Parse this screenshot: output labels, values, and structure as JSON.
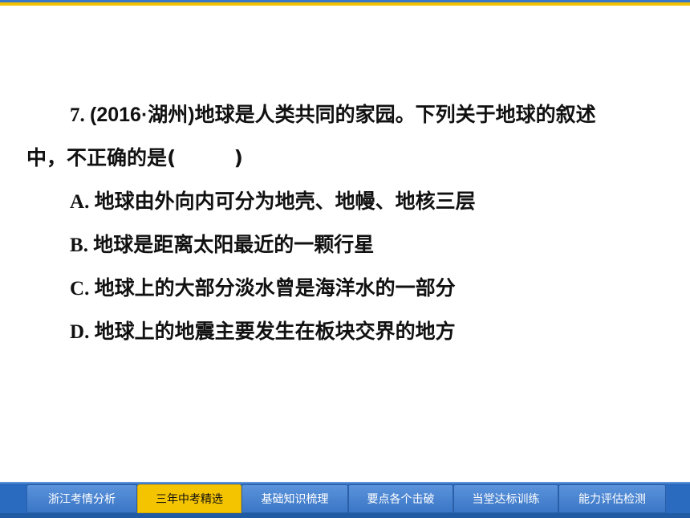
{
  "question": {
    "number": "7",
    "number_sep": ". ",
    "source": "(2016·湖州)",
    "stem_line1": "地球是人类共同的家园。下列关于地球的叙述",
    "stem_line2": "中，不正确的是(",
    "blank_close": ")",
    "options": [
      {
        "letter": "A",
        "sep": ". ",
        "text": "地球由外向内可分为地壳、地幔、地核三层"
      },
      {
        "letter": "B",
        "sep": ". ",
        "text": "地球是距离太阳最近的一颗行星"
      },
      {
        "letter": "C",
        "sep": ". ",
        "text": "地球上的大部分淡水曾是海洋水的一部分"
      },
      {
        "letter": "D",
        "sep": ". ",
        "text": "地球上的地震主要发生在板块交界的地方"
      }
    ]
  },
  "nav": {
    "tabs": [
      {
        "label": "浙江考情分析"
      },
      {
        "label": "三年中考精选",
        "active": true
      },
      {
        "label": "基础知识梳理"
      },
      {
        "label": "要点各个击破"
      },
      {
        "label": "当堂达标训练"
      },
      {
        "label": "能力评估检测"
      }
    ]
  },
  "colors": {
    "accent_blue": "#2a6bbf",
    "accent_yellow": "#f5c400"
  }
}
